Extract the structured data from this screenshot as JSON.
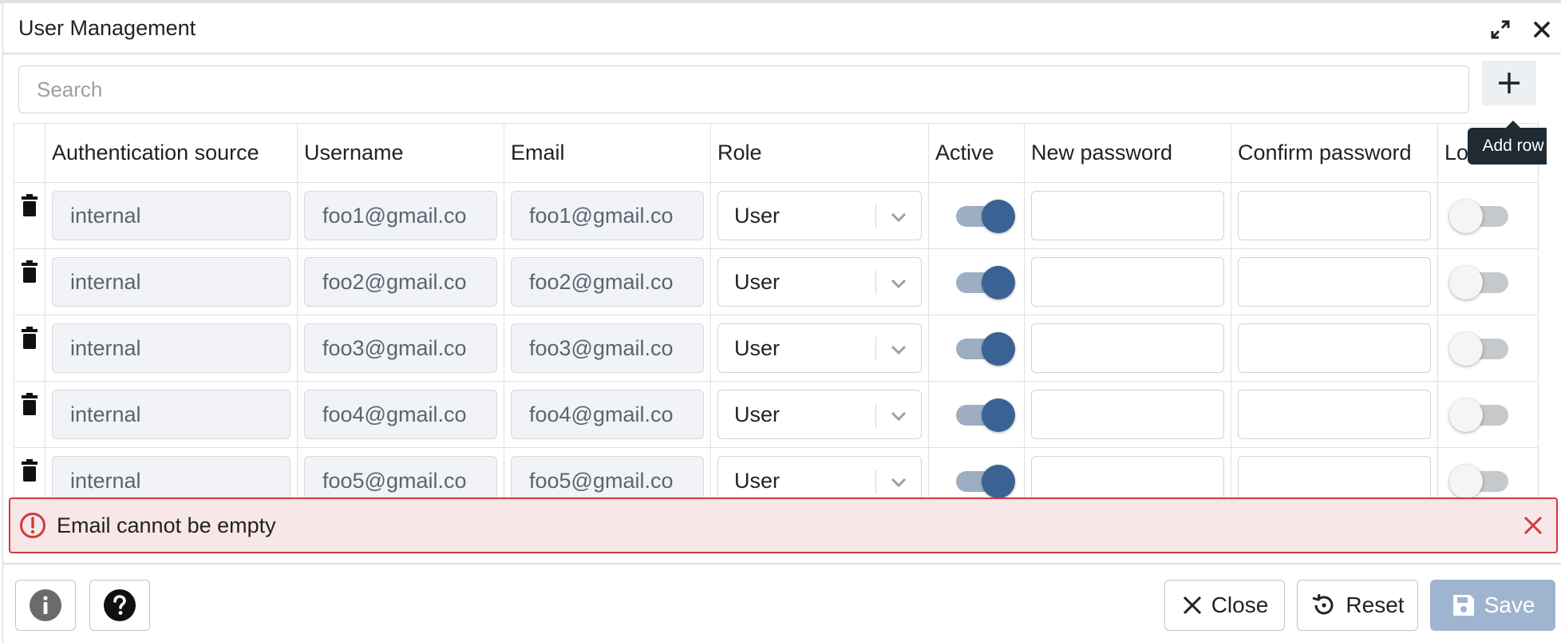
{
  "dialog": {
    "title": "User Management"
  },
  "search": {
    "placeholder": "Search"
  },
  "tooltip": {
    "add_row": "Add row"
  },
  "table": {
    "columns": [
      "Authentication source",
      "Username",
      "Email",
      "Role",
      "Active",
      "New password",
      "Confirm password",
      "Lo"
    ],
    "rows": [
      {
        "auth_source": "internal",
        "username": "foo1@gmail.co",
        "email": "foo1@gmail.co",
        "role": "User",
        "active": true,
        "locked": false
      },
      {
        "auth_source": "internal",
        "username": "foo2@gmail.co",
        "email": "foo2@gmail.co",
        "role": "User",
        "active": true,
        "locked": false
      },
      {
        "auth_source": "internal",
        "username": "foo3@gmail.co",
        "email": "foo3@gmail.co",
        "role": "User",
        "active": true,
        "locked": false
      },
      {
        "auth_source": "internal",
        "username": "foo4@gmail.co",
        "email": "foo4@gmail.co",
        "role": "User",
        "active": true,
        "locked": false
      },
      {
        "auth_source": "internal",
        "username": "foo5@gmail.co",
        "email": "foo5@gmail.co",
        "role": "User",
        "active": true,
        "locked": false
      }
    ]
  },
  "error": {
    "message": "Email cannot be empty"
  },
  "footer": {
    "close_label": "Close",
    "reset_label": "Reset",
    "save_label": "Save"
  },
  "icons": {
    "expand": "expand-icon",
    "close": "close-icon",
    "add": "plus-icon",
    "delete": "trash-icon",
    "error": "alert-circle-icon",
    "dismiss": "x-icon",
    "info": "info-icon",
    "help": "help-icon",
    "reset": "reset-icon",
    "save": "save-icon"
  },
  "colors": {
    "accent": "#3a6394",
    "error_border": "#cf3b3b",
    "error_bg": "#f7e7e8",
    "save_disabled": "#9fb5cf"
  }
}
